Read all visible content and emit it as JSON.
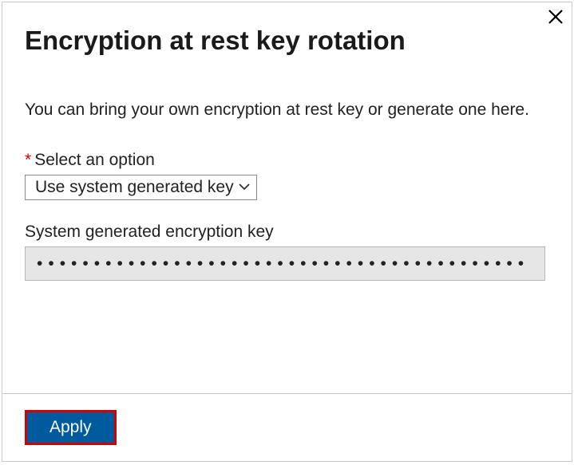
{
  "header": {
    "title": "Encryption at rest key rotation"
  },
  "body": {
    "description": "You can bring your own encryption at rest key or generate one here.",
    "option_label": "Select an option",
    "required_marker": "*",
    "selected_option": "Use system generated key",
    "key_label": "System generated encryption key",
    "key_value_masked": "•••••••••••••••••••••••••••••••••••••••••••"
  },
  "footer": {
    "apply_label": "Apply"
  }
}
